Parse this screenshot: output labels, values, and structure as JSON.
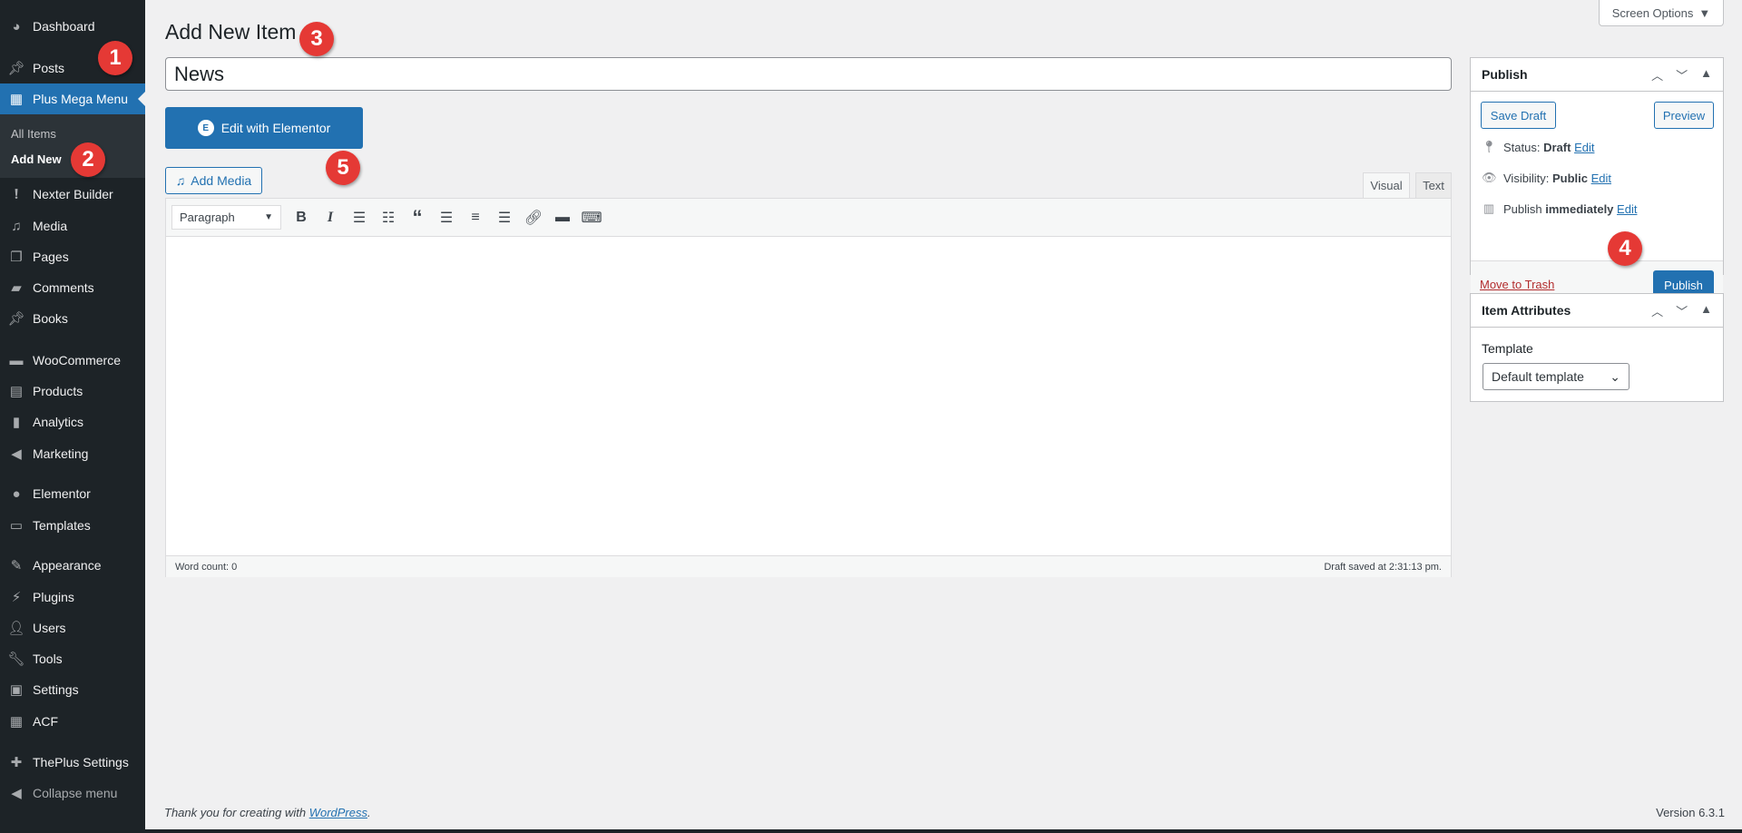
{
  "sidebar": {
    "items": [
      {
        "label": "Dashboard",
        "icon": "dashboard-icon"
      },
      {
        "label": "Posts",
        "icon": "pin-icon"
      },
      {
        "label": "Plus Mega Menu",
        "icon": "mega-menu-icon"
      },
      {
        "label": "Nexter Builder",
        "icon": "exclamation-icon"
      },
      {
        "label": "Media",
        "icon": "media-icon"
      },
      {
        "label": "Pages",
        "icon": "pages-icon"
      },
      {
        "label": "Comments",
        "icon": "comment-icon"
      },
      {
        "label": "Books",
        "icon": "pin-icon"
      },
      {
        "label": "WooCommerce",
        "icon": "woo-icon"
      },
      {
        "label": "Products",
        "icon": "archive-icon"
      },
      {
        "label": "Analytics",
        "icon": "bar-chart-icon"
      },
      {
        "label": "Marketing",
        "icon": "megaphone-icon"
      },
      {
        "label": "Elementor",
        "icon": "elementor-icon"
      },
      {
        "label": "Templates",
        "icon": "folder-icon"
      },
      {
        "label": "Appearance",
        "icon": "brush-icon"
      },
      {
        "label": "Plugins",
        "icon": "plug-icon"
      },
      {
        "label": "Users",
        "icon": "user-icon"
      },
      {
        "label": "Tools",
        "icon": "wrench-icon"
      },
      {
        "label": "Settings",
        "icon": "sliders-icon"
      },
      {
        "label": "ACF",
        "icon": "table-icon"
      },
      {
        "label": "ThePlus Settings",
        "icon": "plus-icon"
      }
    ],
    "submenu": {
      "all_items": "All Items",
      "add_new": "Add New"
    },
    "collapse": "Collapse menu"
  },
  "header": {
    "screen_options": "Screen Options",
    "title": "Add New Item"
  },
  "editor": {
    "title_value": "News",
    "elementor_button": "Edit with Elementor",
    "add_media": "Add Media",
    "tabs": {
      "visual": "Visual",
      "text": "Text"
    },
    "format": "Paragraph",
    "word_count": "Word count: 0",
    "draft_saved": "Draft saved at 2:31:13 pm."
  },
  "publish_box": {
    "title": "Publish",
    "save_draft": "Save Draft",
    "preview": "Preview",
    "status_label": "Status:",
    "status_value": "Draft",
    "visibility_label": "Visibility:",
    "visibility_value": "Public",
    "publish_label": "Publish",
    "publish_value": "immediately",
    "edit": "Edit",
    "move_to_trash": "Move to Trash",
    "publish_button": "Publish"
  },
  "attributes_box": {
    "title": "Item Attributes",
    "template_label": "Template",
    "template_value": "Default template"
  },
  "footer": {
    "thanks": "Thank you for creating with ",
    "wordpress": "WordPress",
    "version": "Version 6.3.1"
  },
  "annotations": [
    "1",
    "2",
    "3",
    "4",
    "5"
  ],
  "colors": {
    "accent": "#2271b1",
    "sidebar": "#1d2327",
    "badge": "#e53935",
    "trash": "#b32d2e"
  }
}
